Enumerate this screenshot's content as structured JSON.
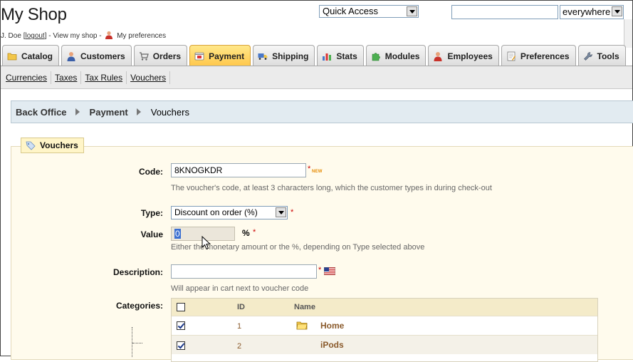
{
  "header": {
    "shop_title": "My Shop",
    "user_name": "J. Doe",
    "logout_label": "logout",
    "view_shop_label": "View my shop",
    "preferences_label": "My preferences",
    "quick_access": "Quick Access",
    "search_value": "",
    "search_scope": "everywhere"
  },
  "tabs": [
    {
      "label": "Catalog",
      "icon": "folder-icon",
      "active": false
    },
    {
      "label": "Customers",
      "icon": "user-icon",
      "active": false
    },
    {
      "label": "Orders",
      "icon": "cart-icon",
      "active": false
    },
    {
      "label": "Payment",
      "icon": "card-icon",
      "active": true
    },
    {
      "label": "Shipping",
      "icon": "truck-icon",
      "active": false
    },
    {
      "label": "Stats",
      "icon": "chart-icon",
      "active": false
    },
    {
      "label": "Modules",
      "icon": "puzzle-icon",
      "active": false
    },
    {
      "label": "Employees",
      "icon": "employee-icon",
      "active": false
    },
    {
      "label": "Preferences",
      "icon": "document-icon",
      "active": false
    },
    {
      "label": "Tools",
      "icon": "wrench-icon",
      "active": false
    }
  ],
  "subtabs": [
    "Currencies",
    "Taxes",
    "Tax Rules",
    "Vouchers"
  ],
  "breadcrumb": {
    "root": "Back Office",
    "section": "Payment",
    "page": "Vouchers"
  },
  "form": {
    "legend": "Vouchers",
    "code_label": "Code:",
    "code_value": "8KNOGKDR",
    "code_badge": "NEW",
    "code_hint": "The voucher's code, at least 3 characters long, which the customer types in during check-out",
    "type_label": "Type:",
    "type_value": "Discount on order (%)",
    "value_label": "Value",
    "value_value": "0",
    "value_unit": "%",
    "value_hint": "Either the monetary amount or the %, depending on Type selected above",
    "description_label": "Description:",
    "description_value": "",
    "description_hint": "Will appear in cart next to voucher code",
    "categories_label": "Categories:",
    "required_mark": "*"
  },
  "categories": {
    "columns": {
      "id": "ID",
      "name": "Name"
    },
    "rows": [
      {
        "id": "1",
        "name": "Home",
        "checked": true
      },
      {
        "id": "2",
        "name": "iPods",
        "checked": true
      }
    ]
  },
  "colors": {
    "active_tab": "#ffc74a",
    "fieldset_bg": "#fffbed",
    "breadcrumb_bg": "#e2ebf1",
    "required": "#cc0000"
  }
}
